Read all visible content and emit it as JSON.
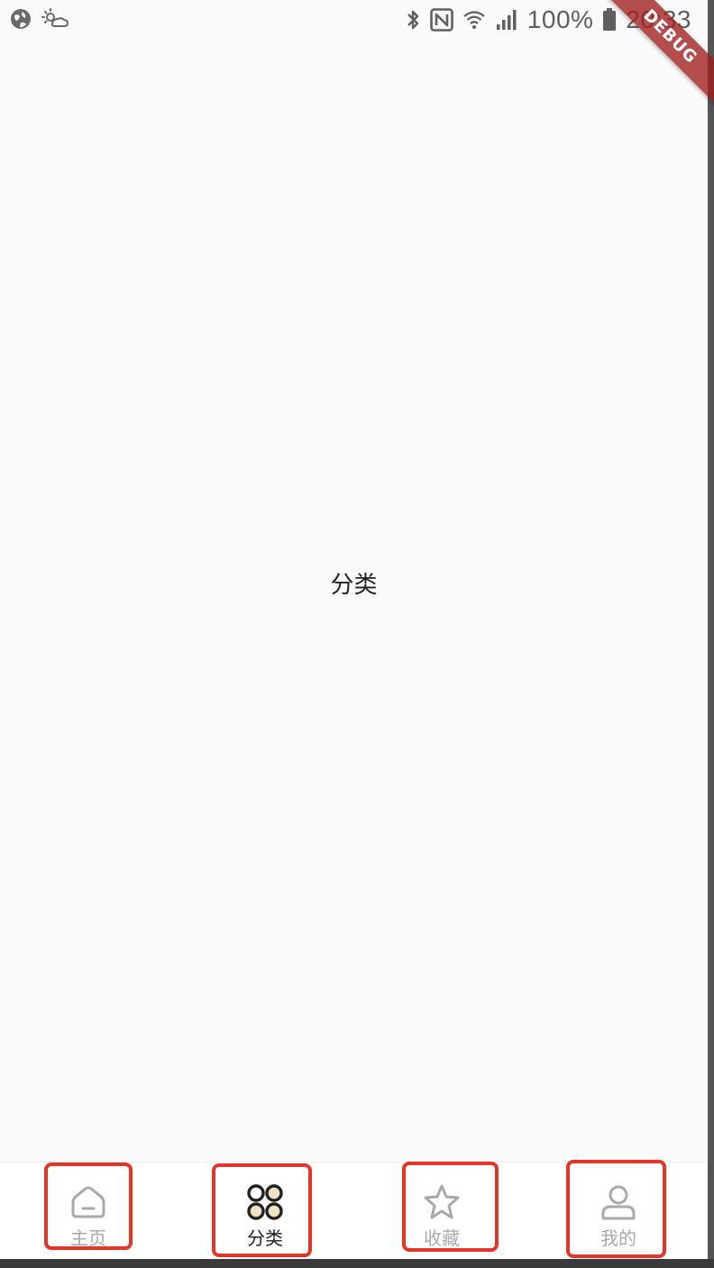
{
  "status_bar": {
    "battery_percent": "100%",
    "time": "20:33",
    "left_icons": [
      "globe-icon",
      "weather-icon"
    ],
    "right_icons": [
      "bluetooth-icon",
      "nfc-icon",
      "wifi-icon",
      "signal-icon",
      "battery-icon"
    ]
  },
  "debug_banner": "DEBUG",
  "page": {
    "center_label": "分类"
  },
  "bottom_nav": {
    "items": [
      {
        "label": "主页",
        "icon": "home-icon",
        "active": false
      },
      {
        "label": "分类",
        "icon": "category-icon",
        "active": true
      },
      {
        "label": "收藏",
        "icon": "star-icon",
        "active": false
      },
      {
        "label": "我的",
        "icon": "user-icon",
        "active": false
      }
    ],
    "active_color": "#222222",
    "inactive_color": "#a9a9a9",
    "highlight_color": "#e53528"
  }
}
